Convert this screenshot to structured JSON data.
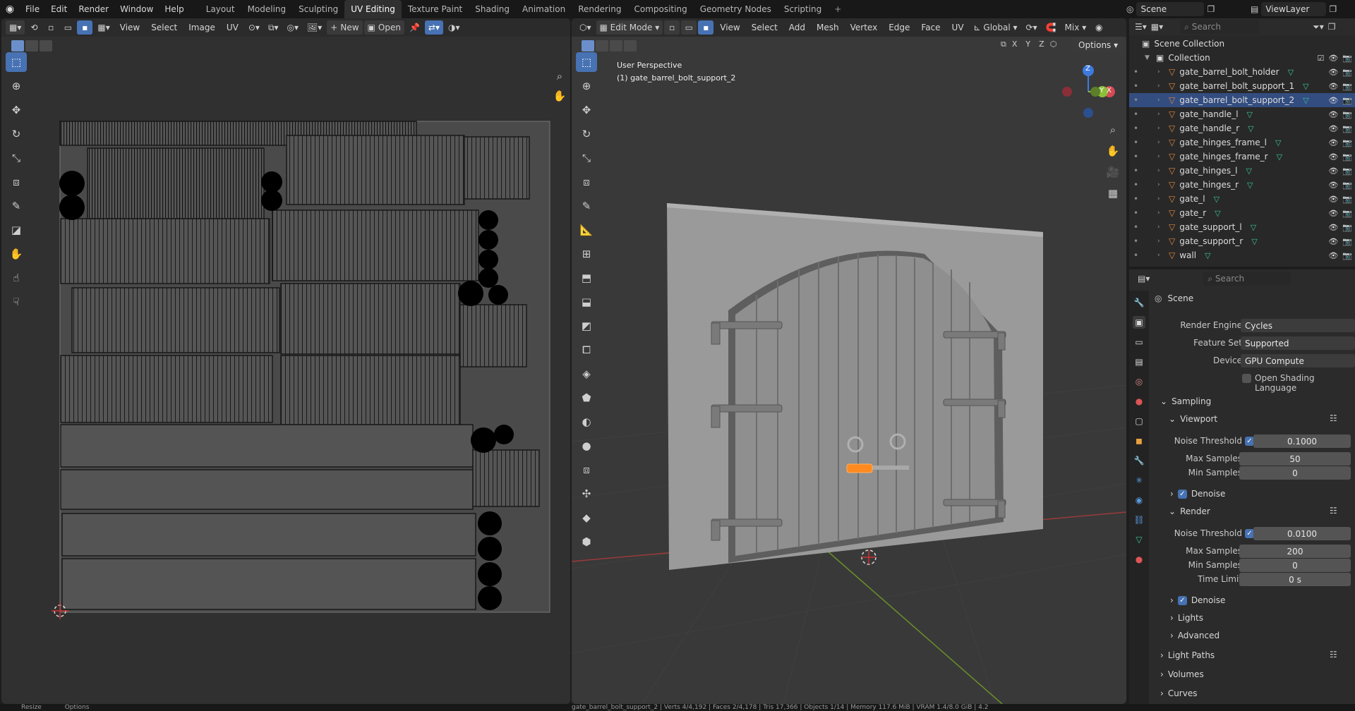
{
  "menu": [
    "File",
    "Edit",
    "Render",
    "Window",
    "Help"
  ],
  "workspaces": [
    {
      "label": "Layout",
      "active": false
    },
    {
      "label": "Modeling",
      "active": false
    },
    {
      "label": "Sculpting",
      "active": false
    },
    {
      "label": "UV Editing",
      "active": true
    },
    {
      "label": "Texture Paint",
      "active": false
    },
    {
      "label": "Shading",
      "active": false
    },
    {
      "label": "Animation",
      "active": false
    },
    {
      "label": "Rendering",
      "active": false
    },
    {
      "label": "Compositing",
      "active": false
    },
    {
      "label": "Geometry Nodes",
      "active": false
    },
    {
      "label": "Scripting",
      "active": false
    }
  ],
  "scene_name": "Scene",
  "viewlayer_name": "ViewLayer",
  "uv_editor": {
    "menus": [
      "View",
      "Select",
      "Image",
      "UV"
    ],
    "new_label": "New",
    "open_label": "Open"
  },
  "viewport": {
    "mode": "Edit Mode",
    "menus": [
      "View",
      "Select",
      "Add",
      "Mesh",
      "Vertex",
      "Edge",
      "Face",
      "UV"
    ],
    "transform": "Global",
    "shading": "Mix",
    "options_label": "Options",
    "info_line1": "User Perspective",
    "info_line2": "(1) gate_barrel_bolt_support_2",
    "axes": [
      "X",
      "Y",
      "Z"
    ],
    "gizmo_axes": {
      "x": "X",
      "y": "Y",
      "z": "Z"
    }
  },
  "outliner": {
    "search_placeholder": "Search",
    "root": "Scene Collection",
    "collection": "Collection",
    "objects": [
      {
        "name": "gate_barrel_bolt_holder",
        "selected": false
      },
      {
        "name": "gate_barrel_bolt_support_1",
        "selected": false
      },
      {
        "name": "gate_barrel_bolt_support_2",
        "selected": true
      },
      {
        "name": "gate_handle_l",
        "selected": false
      },
      {
        "name": "gate_handle_r",
        "selected": false
      },
      {
        "name": "gate_hinges_frame_l",
        "selected": false
      },
      {
        "name": "gate_hinges_frame_r",
        "selected": false
      },
      {
        "name": "gate_hinges_l",
        "selected": false
      },
      {
        "name": "gate_hinges_r",
        "selected": false
      },
      {
        "name": "gate_l",
        "selected": false
      },
      {
        "name": "gate_r",
        "selected": false
      },
      {
        "name": "gate_support_l",
        "selected": false
      },
      {
        "name": "gate_support_r",
        "selected": false
      },
      {
        "name": "wall",
        "selected": false
      }
    ]
  },
  "properties": {
    "search_placeholder": "Search",
    "context": "Scene",
    "render_engine_label": "Render Engine",
    "render_engine": "Cycles",
    "feature_set_label": "Feature Set",
    "feature_set": "Supported",
    "device_label": "Device",
    "device": "GPU Compute",
    "osl_label": "Open Shading Language",
    "sampling": "Sampling",
    "viewport": "Viewport",
    "render": "Render",
    "noise_threshold_label": "Noise Threshold",
    "max_samples_label": "Max Samples",
    "min_samples_label": "Min Samples",
    "time_limit_label": "Time Limit",
    "vp_noise": "0.1000",
    "vp_max": "50",
    "vp_min": "0",
    "r_noise": "0.0100",
    "r_max": "200",
    "r_min": "0",
    "r_time": "0 s",
    "denoise": "Denoise",
    "lights": "Lights",
    "advanced": "Advanced",
    "light_paths": "Light Paths",
    "volumes": "Volumes",
    "curves": "Curves"
  },
  "status_bar": {
    "left1": "Resize",
    "left2": "Options",
    "right": "gate_barrel_bolt_support_2 | Verts 4/4,192 | Faces 2/4,178 | Tris 17,366 | Objects 1/14 | Memory 117.6 MiB | VRAM 1.4/8.0 GiB | 4.2"
  },
  "colors": {
    "accent": "#4772b3",
    "selection_orange": "#ff8a1f",
    "x_axis": "#d44a55",
    "y_axis": "#8bbf3a",
    "z_axis": "#3d7ae0"
  }
}
